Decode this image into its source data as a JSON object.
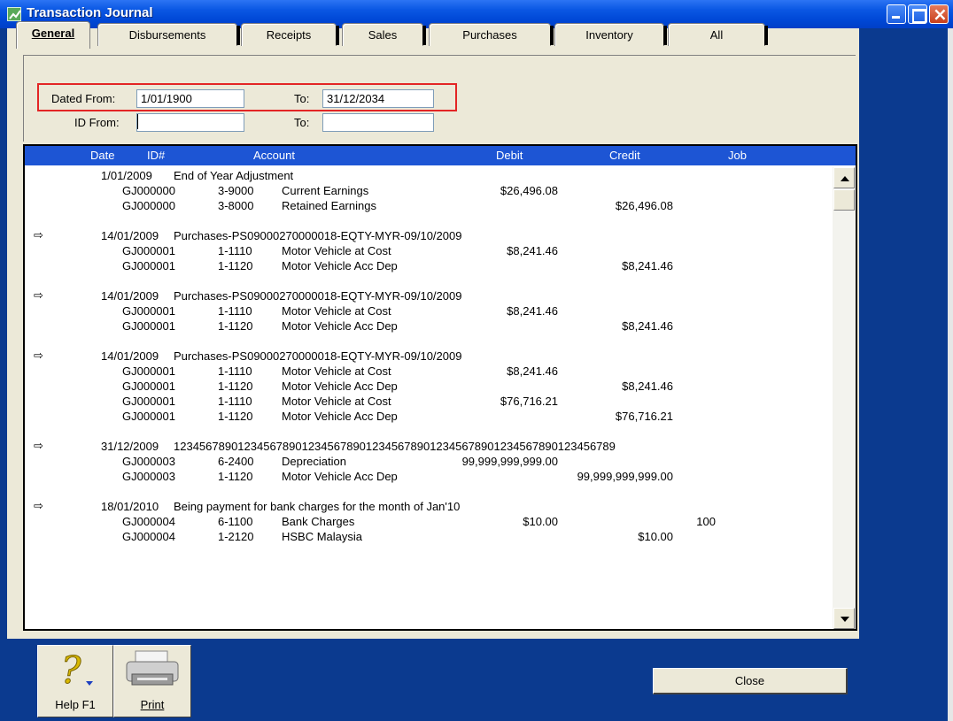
{
  "window": {
    "title": "Transaction Journal"
  },
  "tabs": [
    {
      "label": "General",
      "active": true
    },
    {
      "label": "Disbursements"
    },
    {
      "label": "Receipts"
    },
    {
      "label": "Sales"
    },
    {
      "label": "Purchases"
    },
    {
      "label": "Inventory"
    },
    {
      "label": "All"
    }
  ],
  "filters": {
    "dated_from_label": "Dated From:",
    "dated_from_value": "1/01/1900",
    "dated_to_label": "To:",
    "dated_to_value": "31/12/2034",
    "id_from_label": "ID From:",
    "id_from_value": "",
    "id_to_label": "To:",
    "id_to_value": ""
  },
  "columns": {
    "date": "Date",
    "id": "ID#",
    "account": "Account",
    "debit": "Debit",
    "credit": "Credit",
    "job": "Job"
  },
  "entries": [
    {
      "arrow": false,
      "date": "1/01/2009",
      "memo": "End of Year Adjustment",
      "lines": [
        {
          "id": "GJ000000",
          "acct": "3-9000",
          "name": "Current Earnings",
          "debit": "$26,496.08",
          "credit": "",
          "job": ""
        },
        {
          "id": "GJ000000",
          "acct": "3-8000",
          "name": "Retained Earnings",
          "debit": "",
          "credit": "$26,496.08",
          "job": ""
        }
      ]
    },
    {
      "arrow": true,
      "date": "14/01/2009",
      "memo": "Purchases-PS09000270000018-EQTY-MYR-09/10/2009",
      "lines": [
        {
          "id": "GJ000001",
          "acct": "1-1110",
          "name": "Motor Vehicle at Cost",
          "debit": "$8,241.46",
          "credit": "",
          "job": ""
        },
        {
          "id": "GJ000001",
          "acct": "1-1120",
          "name": "Motor Vehicle Acc Dep",
          "debit": "",
          "credit": "$8,241.46",
          "job": ""
        }
      ]
    },
    {
      "arrow": true,
      "date": "14/01/2009",
      "memo": "Purchases-PS09000270000018-EQTY-MYR-09/10/2009",
      "lines": [
        {
          "id": "GJ000001",
          "acct": "1-1110",
          "name": "Motor Vehicle at Cost",
          "debit": "$8,241.46",
          "credit": "",
          "job": ""
        },
        {
          "id": "GJ000001",
          "acct": "1-1120",
          "name": "Motor Vehicle Acc Dep",
          "debit": "",
          "credit": "$8,241.46",
          "job": ""
        }
      ]
    },
    {
      "arrow": true,
      "date": "14/01/2009",
      "memo": "Purchases-PS09000270000018-EQTY-MYR-09/10/2009",
      "lines": [
        {
          "id": "GJ000001",
          "acct": "1-1110",
          "name": "Motor Vehicle at Cost",
          "debit": "$8,241.46",
          "credit": "",
          "job": ""
        },
        {
          "id": "GJ000001",
          "acct": "1-1120",
          "name": "Motor Vehicle Acc Dep",
          "debit": "",
          "credit": "$8,241.46",
          "job": ""
        },
        {
          "id": "GJ000001",
          "acct": "1-1110",
          "name": "Motor Vehicle at Cost",
          "debit": "$76,716.21",
          "credit": "",
          "job": ""
        },
        {
          "id": "GJ000001",
          "acct": "1-1120",
          "name": "Motor Vehicle Acc Dep",
          "debit": "",
          "credit": "$76,716.21",
          "job": ""
        }
      ]
    },
    {
      "arrow": true,
      "date": "31/12/2009",
      "memo": "123456789012345678901234567890123456789012345678901234567890123456789",
      "lines": [
        {
          "id": "GJ000003",
          "acct": "6-2400",
          "name": "Depreciation",
          "debit": "99,999,999,999.00",
          "credit": "",
          "job": ""
        },
        {
          "id": "GJ000003",
          "acct": "1-1120",
          "name": "Motor Vehicle Acc Dep",
          "debit": "",
          "credit": "99,999,999,999.00",
          "job": ""
        }
      ]
    },
    {
      "arrow": true,
      "date": "18/01/2010",
      "memo": "Being payment for bank charges for the month of Jan'10",
      "lines": [
        {
          "id": "GJ000004",
          "acct": "6-1100",
          "name": "Bank Charges",
          "debit": "$10.00",
          "credit": "",
          "job": "100"
        },
        {
          "id": "GJ000004",
          "acct": "1-2120",
          "name": "HSBC Malaysia",
          "debit": "",
          "credit": "$10.00",
          "job": ""
        }
      ]
    }
  ],
  "buttons": {
    "help": "Help F1",
    "print": "Print",
    "close": "Close"
  },
  "icons": {
    "help": "question-mark-icon",
    "print": "printer-icon",
    "row_arrow": "arrow-right-icon"
  },
  "colors": {
    "titlebar": "#0a57e3",
    "background": "#0b3a8f",
    "header": "#1d55d4",
    "highlight": "#e32525"
  }
}
